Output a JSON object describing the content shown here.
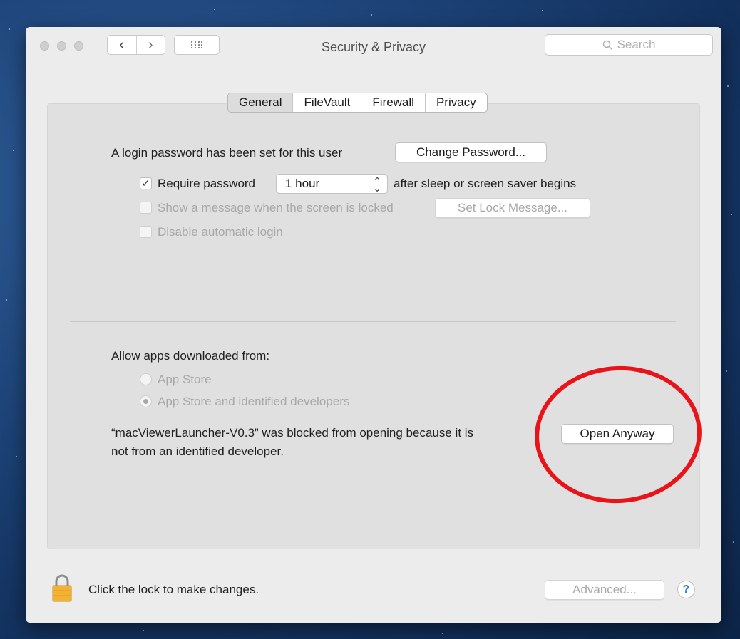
{
  "window": {
    "title": "Security & Privacy",
    "search_placeholder": "Search"
  },
  "tabs": [
    {
      "label": "General",
      "selected": true
    },
    {
      "label": "FileVault",
      "selected": false
    },
    {
      "label": "Firewall",
      "selected": false
    },
    {
      "label": "Privacy",
      "selected": false
    }
  ],
  "general": {
    "login_text": "A login password has been set for this user",
    "change_password_label": "Change Password...",
    "require_password_label": "Require password",
    "require_password_checked": true,
    "require_password_value": "1 hour",
    "after_sleep_text": "after sleep or screen saver begins",
    "show_message_label": "Show a message when the screen is locked",
    "set_lock_message_label": "Set Lock Message...",
    "disable_autologin_label": "Disable automatic login"
  },
  "downloads": {
    "heading": "Allow apps downloaded from:",
    "option_app_store": "App Store",
    "option_identified": "App Store and identified developers",
    "selected_option": "App Store and identified developers",
    "blocked_line1": "“macViewerLauncher-V0.3” was blocked from opening because it is",
    "blocked_line2": "not from an identified developer.",
    "open_anyway_label": "Open Anyway"
  },
  "footer": {
    "lock_text": "Click the lock to make changes.",
    "advanced_label": "Advanced...",
    "help_label": "?"
  },
  "colors": {
    "annotation_circle": "#e8141a",
    "lock_gold": "#f2b233"
  }
}
